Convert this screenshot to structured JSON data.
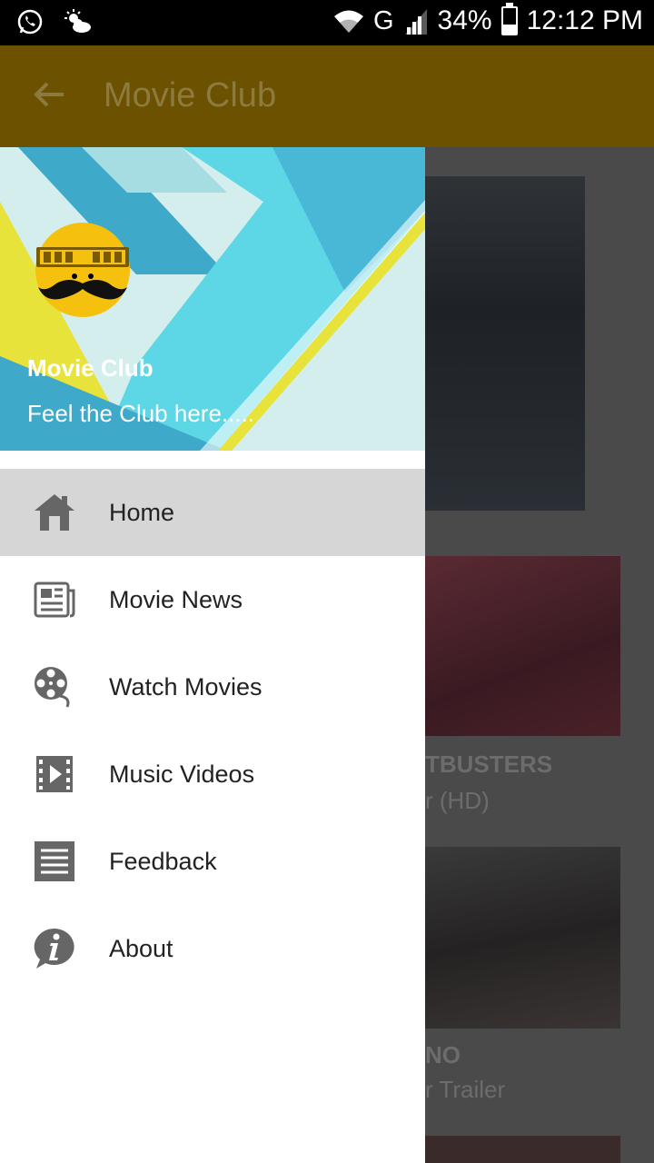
{
  "status_bar": {
    "network": "G",
    "battery": "34%",
    "battery_level": 0.34,
    "time": "12:12 PM",
    "icons": [
      "whatsapp-icon",
      "weather-icon",
      "wifi-icon",
      "signal-icon",
      "battery-icon"
    ]
  },
  "toolbar": {
    "title": "Movie Club",
    "color": "#6b5100"
  },
  "drawer": {
    "app_name": "Movie Club",
    "tagline": "Feel the Club here.....",
    "items": [
      {
        "label": "Home",
        "icon": "home-icon",
        "active": true
      },
      {
        "label": "Movie News",
        "icon": "newspaper-icon",
        "active": false
      },
      {
        "label": "Watch Movies",
        "icon": "film-reel-icon",
        "active": false
      },
      {
        "label": "Music Videos",
        "icon": "video-icon",
        "active": false
      },
      {
        "label": "Feedback",
        "icon": "feedback-icon",
        "active": false
      },
      {
        "label": "About",
        "icon": "info-icon",
        "active": false
      }
    ]
  },
  "background": {
    "cards": [
      {
        "title": "TBUSTERS",
        "subtitle": "r (HD)"
      },
      {
        "title": "NO",
        "subtitle": "r Trailer"
      }
    ]
  }
}
